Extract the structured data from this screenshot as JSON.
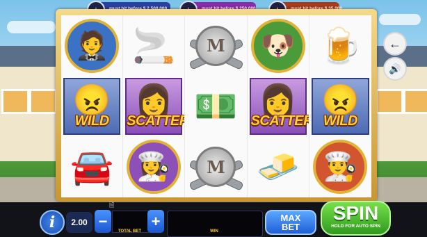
{
  "jackpots": [
    {
      "icon": "★",
      "text": "must hit before $ 2,500,000",
      "color": "#2b3fa0",
      "star_color": "#5ea8ff"
    },
    {
      "icon": "★",
      "text": "must hit before $ 250,000",
      "color": "#8a2aa8",
      "star_color": "#f05bdc"
    },
    {
      "icon": "★",
      "text": "must hit before $ 35,000",
      "color": "#a83a1a",
      "star_color": "#ff9a3a"
    }
  ],
  "reels": {
    "row1": [
      {
        "symbol": "🤵",
        "type": "portrait",
        "bg": "#3b72c4"
      },
      {
        "symbol": "🚬",
        "type": "plain"
      },
      {
        "symbol": "M",
        "type": "coin"
      },
      {
        "symbol": "🐶",
        "type": "portrait",
        "bg": "#4c9b3a"
      },
      {
        "symbol": "🍺",
        "type": "plain"
      }
    ],
    "row2": [
      {
        "symbol": "😠",
        "type": "wild",
        "label": "WILD"
      },
      {
        "symbol": "👩",
        "type": "scatter",
        "label": "SCATTER"
      },
      {
        "symbol": "💵",
        "type": "plain"
      },
      {
        "symbol": "👩",
        "type": "scatter",
        "label": "SCATTER"
      },
      {
        "symbol": "😠",
        "type": "wild",
        "label": "WILD"
      }
    ],
    "row3": [
      {
        "symbol": "🚘",
        "type": "plain"
      },
      {
        "symbol": "👩‍🍳",
        "type": "portrait",
        "bg": "#8d4fb8"
      },
      {
        "symbol": "M",
        "type": "coin"
      },
      {
        "symbol": "🧈",
        "type": "plain"
      },
      {
        "symbol": "👨‍🍳",
        "type": "portrait",
        "bg": "#d1552e"
      }
    ]
  },
  "side": {
    "back_icon": "←",
    "sound_icon": "🔊"
  },
  "controls": {
    "info_icon": "i",
    "bet_value": "2.00",
    "minus": "−",
    "plus": "+",
    "total_bet_label": "TOTAL BET",
    "win_label": "WIN",
    "max_bet_line1": "MAX",
    "max_bet_line2": "BET",
    "spin_label": "SPIN",
    "spin_sub": "HOLD FOR AUTO SPIN",
    "doc_icon": "🗎"
  }
}
